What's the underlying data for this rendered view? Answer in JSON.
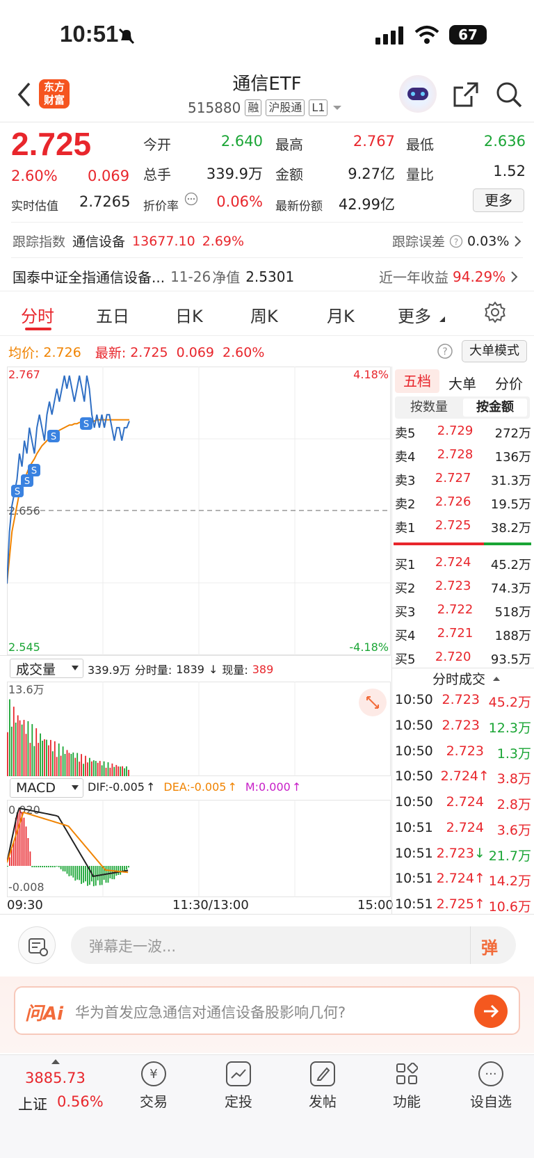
{
  "status_bar": {
    "time": "10:51",
    "battery": "67"
  },
  "header": {
    "logo_text": "东方财富",
    "title": "通信ETF",
    "code": "515880",
    "tags": [
      "融",
      "沪股通",
      "L1"
    ]
  },
  "quote": {
    "price": "2.725",
    "change_pct": "2.60%",
    "change": "0.069",
    "iopv_label": "实时估值",
    "iopv": "2.7265",
    "fields": [
      {
        "label": "今开",
        "value": "2.640",
        "color": "green"
      },
      {
        "label": "最高",
        "value": "2.767",
        "color": "red"
      },
      {
        "label": "最低",
        "value": "2.636",
        "color": "green"
      },
      {
        "label": "总手",
        "value": "339.9万",
        "color": "black"
      },
      {
        "label": "金额",
        "value": "9.27亿",
        "color": "black"
      },
      {
        "label": "量比",
        "value": "1.52",
        "color": "black"
      }
    ],
    "discount_label": "折价率",
    "discount": "0.06%",
    "shares_label": "最新份额",
    "shares": "42.99亿",
    "more_button": "更多"
  },
  "tracking": {
    "index_label": "跟踪指数",
    "index_name": "通信设备",
    "index_value": "13677.10",
    "index_pct": "2.69%",
    "error_label": "跟踪误差",
    "error_value": "0.03%"
  },
  "fund": {
    "name": "国泰中证全指通信设备...",
    "nav_date": "11-26",
    "nav_label": "净值",
    "nav": "2.5301",
    "year_label": "近一年收益",
    "year_return": "94.29%"
  },
  "tabs": [
    "分时",
    "五日",
    "日K",
    "周K",
    "月K",
    "更多"
  ],
  "chart_info": {
    "avg_label": "均价:",
    "avg": "2.726",
    "latest_label": "最新:",
    "latest": "2.725",
    "change": "0.069",
    "pct": "2.60%",
    "big_order_mode": "大单模式"
  },
  "chart_data": {
    "type": "line",
    "title": "",
    "y_top": "2.767",
    "y_mid": "2.656",
    "y_bottom": "2.545",
    "pct_top": "4.18%",
    "pct_bottom": "-4.18%",
    "ylim": [
      2.545,
      2.767
    ],
    "x_labels": [
      "09:30",
      "11:30/13:00",
      "15:00"
    ],
    "price": [
      2.6,
      2.64,
      2.66,
      2.67,
      2.68,
      2.7,
      2.69,
      2.71,
      2.7,
      2.72,
      2.71,
      2.7,
      2.72,
      2.73,
      2.72,
      2.71,
      2.73,
      2.74,
      2.73,
      2.74,
      2.75,
      2.74,
      2.75,
      2.76,
      2.75,
      2.76,
      2.75,
      2.74,
      2.75,
      2.76,
      2.75,
      2.74,
      2.76,
      2.75,
      2.73,
      2.72,
      2.73,
      2.72,
      2.73,
      2.72,
      2.73,
      2.73,
      2.72,
      2.71,
      2.72,
      2.72,
      2.71,
      2.72,
      2.72,
      2.725
    ],
    "average": [
      2.6,
      2.62,
      2.64,
      2.65,
      2.66,
      2.67,
      2.675,
      2.68,
      2.685,
      2.69,
      2.693,
      2.696,
      2.7,
      2.703,
      2.706,
      2.708,
      2.71,
      2.712,
      2.714,
      2.716,
      2.717,
      2.718,
      2.719,
      2.72,
      2.721,
      2.722,
      2.722,
      2.723,
      2.723,
      2.724,
      2.724,
      2.724,
      2.725,
      2.725,
      2.725,
      2.725,
      2.726,
      2.726,
      2.726,
      2.726,
      2.726,
      2.726,
      2.726,
      2.726,
      2.726,
      2.726,
      2.726,
      2.726,
      2.726,
      2.726
    ]
  },
  "volume_panel": {
    "selector": "成交量",
    "total": "339.9万",
    "minute_label": "分时量:",
    "minute": "1839",
    "now_label": "现量:",
    "now": "389",
    "max_label": "13.6万"
  },
  "macd_panel": {
    "selector": "MACD",
    "dif": "DIF:-0.005",
    "dea": "DEA:-0.005",
    "m": "M:0.000",
    "top": "0.020",
    "bottom": "-0.008"
  },
  "orderbook": {
    "tabs": [
      "五档",
      "大单",
      "分价"
    ],
    "sub_tabs": [
      "按数量",
      "按金额"
    ],
    "asks": [
      {
        "label": "卖5",
        "price": "2.729",
        "amount": "272万"
      },
      {
        "label": "卖4",
        "price": "2.728",
        "amount": "136万"
      },
      {
        "label": "卖3",
        "price": "2.727",
        "amount": "31.3万"
      },
      {
        "label": "卖2",
        "price": "2.726",
        "amount": "19.5万"
      },
      {
        "label": "卖1",
        "price": "2.725",
        "amount": "38.2万"
      }
    ],
    "bids": [
      {
        "label": "买1",
        "price": "2.724",
        "amount": "45.2万"
      },
      {
        "label": "买2",
        "price": "2.723",
        "amount": "74.3万"
      },
      {
        "label": "买3",
        "price": "2.722",
        "amount": "518万"
      },
      {
        "label": "买4",
        "price": "2.721",
        "amount": "188万"
      },
      {
        "label": "买5",
        "price": "2.720",
        "amount": "93.5万"
      }
    ],
    "trades_title": "分时成交",
    "trades": [
      {
        "time": "10:50",
        "price": "2.723",
        "arrow": "",
        "amount": "45.2万",
        "color": "red"
      },
      {
        "time": "10:50",
        "price": "2.723",
        "arrow": "",
        "amount": "12.3万",
        "color": "green"
      },
      {
        "time": "10:50",
        "price": "2.723",
        "arrow": "",
        "amount": "1.3万",
        "color": "green"
      },
      {
        "time": "10:50",
        "price": "2.724",
        "arrow": "↑",
        "amount": "3.8万",
        "color": "red"
      },
      {
        "time": "10:50",
        "price": "2.724",
        "arrow": "",
        "amount": "2.8万",
        "color": "red"
      },
      {
        "time": "10:51",
        "price": "2.724",
        "arrow": "",
        "amount": "3.6万",
        "color": "red"
      },
      {
        "time": "10:51",
        "price": "2.723",
        "arrow": "↓",
        "amount": "21.7万",
        "color": "green"
      },
      {
        "time": "10:51",
        "price": "2.724",
        "arrow": "↑",
        "amount": "14.2万",
        "color": "red"
      },
      {
        "time": "10:51",
        "price": "2.725",
        "arrow": "↑",
        "amount": "10.6万",
        "color": "red"
      }
    ]
  },
  "comment_bar": {
    "placeholder": "弹幕走一波...",
    "danmu_button": "弹"
  },
  "ai_bar": {
    "logo": "问Ai",
    "question": "华为首发应急通信对通信设备股影响几何?"
  },
  "bottom_nav": {
    "index_value": "3885.73",
    "index_name": "上证",
    "index_pct": "0.56%",
    "items": [
      "交易",
      "定投",
      "发帖",
      "功能",
      "设自选"
    ]
  },
  "colors": {
    "red": "#e8262c",
    "green": "#1aa535",
    "orange": "#f08300",
    "blue": "#2f6fc4"
  }
}
